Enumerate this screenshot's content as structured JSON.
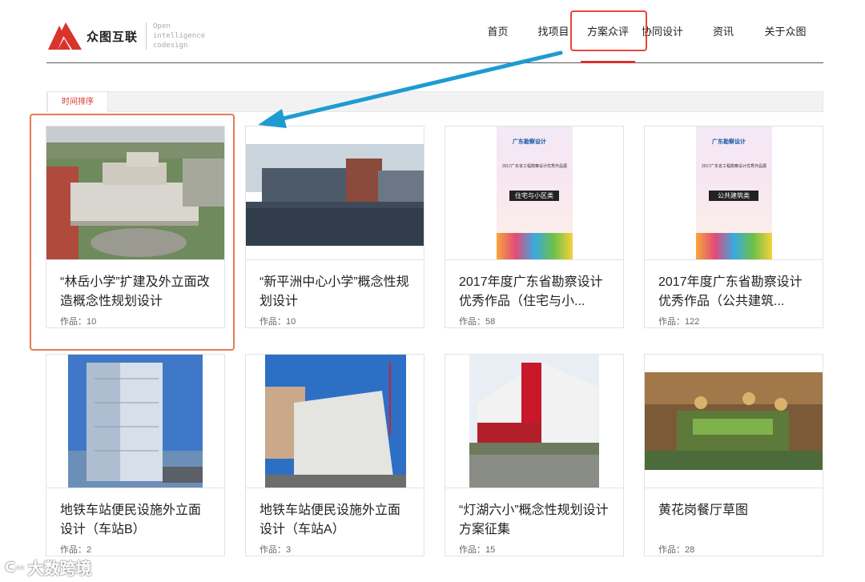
{
  "header": {
    "logo_text": "众图互联",
    "slogan": [
      "Open",
      "intelligence",
      "codesign"
    ]
  },
  "nav": {
    "items": [
      {
        "label": "首页",
        "active": false
      },
      {
        "label": "找项目",
        "active": false
      },
      {
        "label": "方案众评",
        "active": true
      },
      {
        "label": "协同设计",
        "active": false
      },
      {
        "label": "资讯",
        "active": false
      },
      {
        "label": "关于众图",
        "active": false
      }
    ]
  },
  "sortbar": {
    "active_tab": "时间排序"
  },
  "cards": [
    {
      "title": "“林岳小学”扩建及外立面改造概念性规划设计",
      "count_label": "作品：",
      "count": "10",
      "image": "aerial-campus-photo"
    },
    {
      "title": "“新平洲中心小学”概念性规划设计",
      "count_label": "作品：",
      "count": "10",
      "image": "lakeside-building-photo"
    },
    {
      "title": "2017年度广东省勘察设计优秀作品（住宅与小...",
      "count_label": "作品：",
      "count": "58",
      "image": "poster-residential",
      "poster": {
        "brand": "广东勘察设计",
        "heading": "2017广东省工程勘察设计优秀作品展",
        "category": "住宅与小区类"
      }
    },
    {
      "title": "2017年度广东省勘察设计优秀作品（公共建筑...",
      "count_label": "作品：",
      "count": "122",
      "image": "poster-public",
      "poster": {
        "brand": "广东勘察设计",
        "heading": "2017广东省工程勘察设计优秀作品展",
        "category": "公共建筑类"
      }
    },
    {
      "title": "地铁车站便民设施外立面设计（车站B）",
      "count_label": "作品：",
      "count": "2",
      "image": "glass-tower-photo"
    },
    {
      "title": "地铁车站便民设施外立面设计（车站A）",
      "count_label": "作品：",
      "count": "3",
      "image": "perforated-facade-photo"
    },
    {
      "title": "“灯湖六小”概念性规划设计方案征集",
      "count_label": "作品：",
      "count": "15",
      "image": "red-white-school-photo"
    },
    {
      "title": "黄花岗餐厅草图",
      "count_label": "作品：",
      "count": "28",
      "image": "restaurant-interior-render"
    }
  ],
  "watermark": "大数跨境",
  "colors": {
    "accent": "#d9342b",
    "annotation": "#e8463d",
    "arrow": "#1f9bd1"
  }
}
